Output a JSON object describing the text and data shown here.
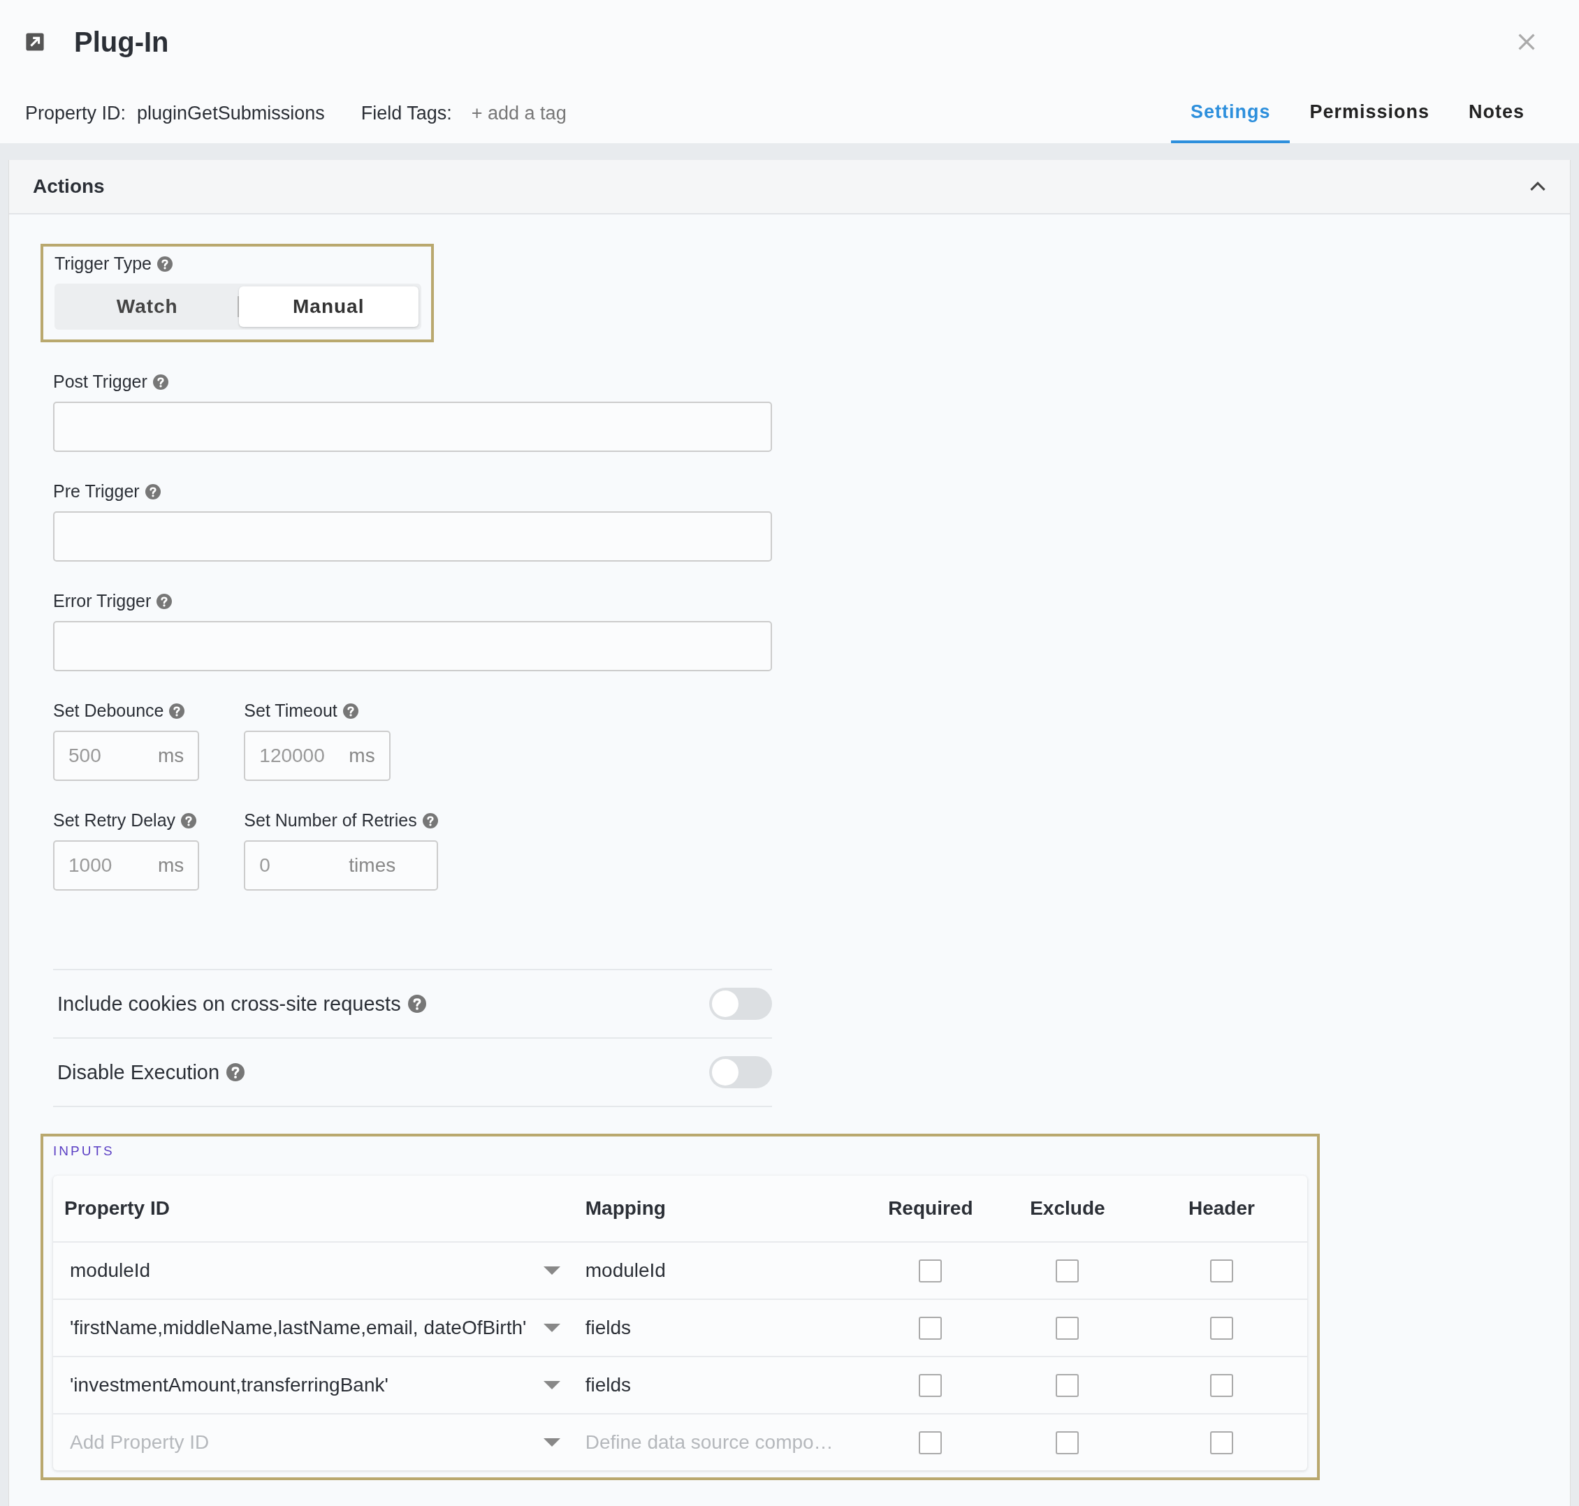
{
  "header": {
    "title": "Plug-In",
    "property_id_label": "Property ID:",
    "property_id": "pluginGetSubmissions",
    "field_tags_label": "Field Tags:",
    "add_tag": "+ add a tag"
  },
  "tabs": [
    {
      "label": "Settings",
      "selected": true
    },
    {
      "label": "Permissions",
      "selected": false
    },
    {
      "label": "Notes",
      "selected": false
    }
  ],
  "section": {
    "title": "Actions",
    "expanded": true
  },
  "trigger_type": {
    "label": "Trigger Type",
    "options": [
      {
        "label": "Watch",
        "selected": false
      },
      {
        "label": "Manual",
        "selected": true
      }
    ]
  },
  "text_fields": [
    {
      "label": "Post Trigger"
    },
    {
      "label": "Pre Trigger"
    },
    {
      "label": "Error Trigger"
    }
  ],
  "number_rows": [
    [
      {
        "label": "Set Debounce",
        "placeholder": "500",
        "unit": "ms"
      },
      {
        "label": "Set Timeout",
        "placeholder": "120000",
        "unit": "ms"
      }
    ],
    [
      {
        "label": "Set Retry Delay",
        "placeholder": "1000",
        "unit": "ms"
      },
      {
        "label": "Set Number of Retries",
        "placeholder": "0",
        "unit": "times"
      }
    ]
  ],
  "toggles": [
    {
      "label": "Include cookies on cross-site requests",
      "on": false
    },
    {
      "label": "Disable Execution",
      "on": false
    }
  ],
  "inputs": {
    "title": "INPUTS",
    "columns": [
      "Property ID",
      "Mapping",
      "Required",
      "Exclude",
      "Header"
    ],
    "rows": [
      {
        "property_id": "moduleId",
        "mapping": "moduleId",
        "required": false,
        "exclude": false,
        "header": false
      },
      {
        "property_id": "'firstName,middleName,lastName,email, dateOfBirth'",
        "mapping": "fields",
        "required": false,
        "exclude": false,
        "header": false
      },
      {
        "property_id": "'investmentAmount,transferringBank'",
        "mapping": "fields",
        "required": false,
        "exclude": false,
        "header": false
      },
      {
        "property_id_placeholder": "Add Property ID",
        "mapping_placeholder": "Define data source compo…",
        "required": false,
        "exclude": false,
        "header": false
      }
    ]
  }
}
